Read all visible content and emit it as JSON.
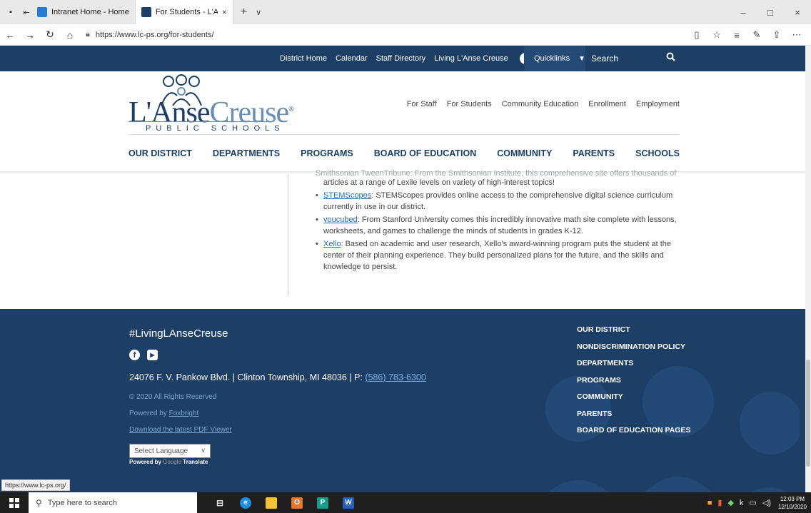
{
  "browser": {
    "tabs": [
      {
        "title": "Intranet Home - Home"
      },
      {
        "title": "For Students - L'Anse C",
        "close": "×"
      }
    ],
    "new_tab": "+",
    "tab_menu": "∨",
    "window_controls": {
      "minimize": "–",
      "maximize": "□",
      "close": "×"
    },
    "url": "https://www.lc-ps.org/for-students/",
    "nav": {
      "back": "←",
      "forward": "→",
      "refresh": "↻",
      "home": "⌂"
    },
    "status_url": "https://www.lc-ps.org/"
  },
  "utility_bar": {
    "links": [
      "District Home",
      "Calendar",
      "Staff Directory",
      "Living L'Anse Creuse"
    ],
    "social": {
      "facebook": "f",
      "youtube": "▶"
    },
    "quicklinks_label": "Quicklinks",
    "search_label": "Search"
  },
  "header": {
    "logo_part1": "L'Anse",
    "logo_part2": "Creuse",
    "logo_reg": "®",
    "logo_subtitle": "PUBLIC SCHOOLS",
    "secondary_nav": [
      "For Staff",
      "For Students",
      "Community Education",
      "Enrollment",
      "Employment"
    ],
    "main_nav": [
      "OUR DISTRICT",
      "DEPARTMENTS",
      "PROGRAMS",
      "BOARD OF EDUCATION",
      "COMMUNITY",
      "PARENTS",
      "SCHOOLS"
    ]
  },
  "content": {
    "partial_top": "Smithsonian TweenTribune: From the Smithsonian Institute, this comprehensive site offers thousands of",
    "items": [
      {
        "link": "",
        "text": "articles at a range of Lexile levels on variety of high-interest topics!"
      },
      {
        "link": "STEMScopes",
        "text": ": STEMScopes provides online access to the comprehensive digital science curriculum currently in use in our district."
      },
      {
        "link": "youcubed",
        "text": ": From Stanford University comes this incredibly innovative math site complete with lessons, worksheets, and games to challenge the minds of students in grades K-12."
      },
      {
        "link": "Xello",
        "text": ": Based on academic and user research, Xello's award-winning program puts the student at the center of their planning experience. They build personalized plans for the future, and the skills and knowledge to persist."
      }
    ]
  },
  "footer": {
    "hashtag": "#LivingLAnseCreuse",
    "address": "24076 F. V. Pankow Blvd.  |  Clinton Township, MI 48036  |  P: ",
    "phone": "(586) 783-6300",
    "copyright": "© 2020 All Rights Reserved",
    "powered_prefix": "Powered by ",
    "powered_link": "Foxbright",
    "pdf_link": "Download the latest PDF Viewer",
    "language_select": "Select Language",
    "translate_prefix": "Powered by ",
    "translate_google": "Google",
    "translate_word": " Translate",
    "links": [
      "OUR DISTRICT",
      "NONDISCRIMINATION POLICY",
      "DEPARTMENTS",
      "PROGRAMS",
      "COMMUNITY",
      "PARENTS",
      "BOARD OF EDUCATION PAGES"
    ]
  },
  "taskbar": {
    "search_placeholder": "Type here to search",
    "time": "12:03 PM",
    "date": "12/10/2020"
  },
  "colors": {
    "brand_navy": "#1d3f66",
    "link_blue": "#2d6cae"
  }
}
